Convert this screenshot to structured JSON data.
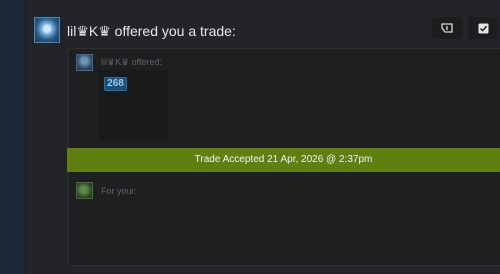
{
  "trade": {
    "title": "lil♛K♛ offered you a trade:",
    "offered_label": "lil♛K♛ offered:",
    "item_count": "268",
    "accepted_status": "Trade Accepted 21 Apr, 2026 @ 2:37pm",
    "for_your_label": "For your:"
  },
  "actions": {
    "flag_icon": "flag-icon",
    "check_icon": "check-icon"
  },
  "colors": {
    "accepted_bar": "#5f8011",
    "item_badge": "#1b4f7a",
    "background": "#232427"
  }
}
